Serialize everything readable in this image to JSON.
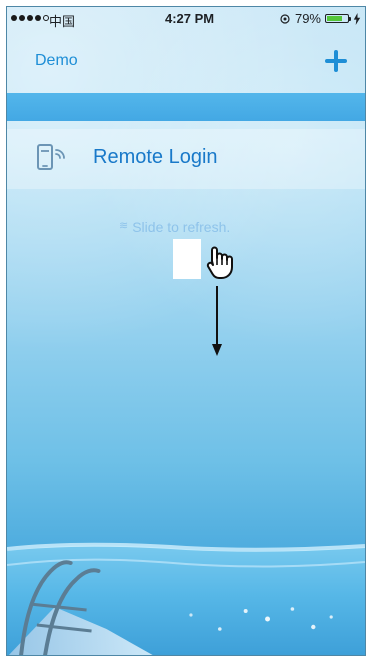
{
  "status_bar": {
    "carrier": "中国",
    "time": "4:27 PM",
    "battery_level": "79%",
    "battery_fill": 0.79
  },
  "nav_bar": {
    "title": "Demo"
  },
  "menu": {
    "remote_login_label": "Remote Login"
  },
  "refresh": {
    "hint": "Slide to refresh."
  }
}
